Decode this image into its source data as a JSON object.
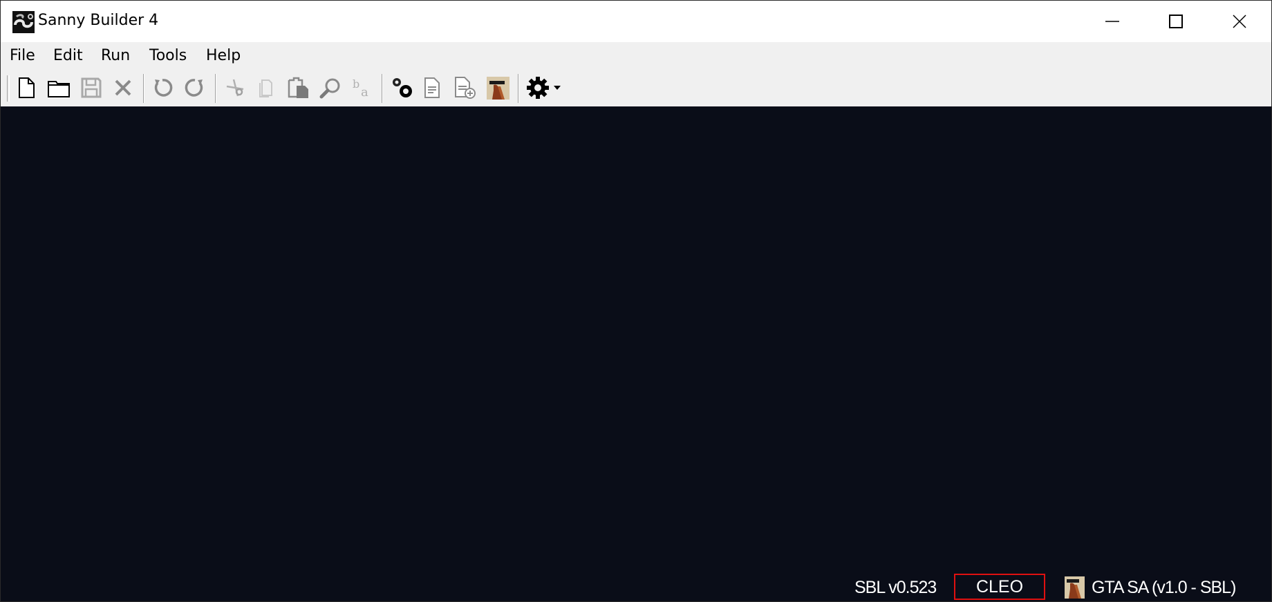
{
  "window": {
    "title": "Sanny Builder 4",
    "controls": {
      "minimize": "minimize-icon",
      "maximize": "maximize-icon",
      "close": "close-icon"
    }
  },
  "menu": {
    "items": [
      {
        "label": "File"
      },
      {
        "label": "Edit"
      },
      {
        "label": "Run"
      },
      {
        "label": "Tools"
      },
      {
        "label": "Help"
      }
    ]
  },
  "toolbar": {
    "buttons": [
      {
        "name": "new-file",
        "icon": "new-file-icon",
        "enabled": true
      },
      {
        "name": "open-file",
        "icon": "open-folder-icon",
        "enabled": true
      },
      {
        "name": "save-file",
        "icon": "save-icon",
        "enabled": false
      },
      {
        "name": "close-file",
        "icon": "close-icon",
        "enabled": false
      },
      {
        "name": "undo",
        "icon": "undo-icon",
        "enabled": false
      },
      {
        "name": "redo",
        "icon": "redo-icon",
        "enabled": false
      },
      {
        "name": "cut",
        "icon": "scissors-icon",
        "enabled": false
      },
      {
        "name": "copy",
        "icon": "copy-icon",
        "enabled": false
      },
      {
        "name": "paste",
        "icon": "paste-icon",
        "enabled": false
      },
      {
        "name": "find",
        "icon": "magnifier-icon",
        "enabled": false
      },
      {
        "name": "replace",
        "icon": "replace-icon",
        "enabled": false
      },
      {
        "name": "compile",
        "icon": "gears-icon",
        "enabled": true
      },
      {
        "name": "document",
        "icon": "document-icon",
        "enabled": true
      },
      {
        "name": "add-document",
        "icon": "document-add-icon",
        "enabled": true
      },
      {
        "name": "game-mode",
        "icon": "game-avatar-icon",
        "enabled": true
      },
      {
        "name": "options",
        "icon": "gear-icon",
        "enabled": true
      },
      {
        "name": "options-dropdown",
        "icon": "caret-down-icon",
        "enabled": true
      }
    ]
  },
  "editor": {
    "background": "#0a0d18"
  },
  "status": {
    "version": "SBL v0.523",
    "mode": "CLEO",
    "mode_border_color": "#e01010",
    "game": "GTA SA (v1.0 - SBL)"
  }
}
